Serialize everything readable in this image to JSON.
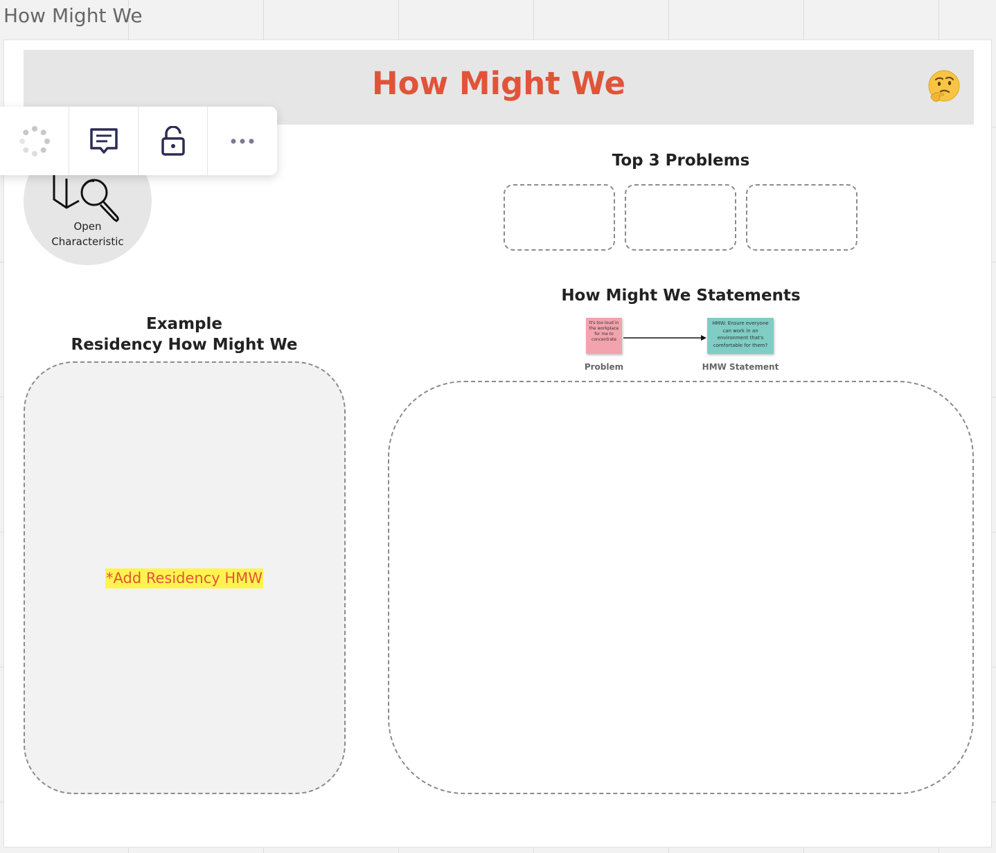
{
  "frame": {
    "title": "How Might We"
  },
  "banner": {
    "title": "How Might We",
    "emoji": "thinking-face-icon"
  },
  "method_card": {
    "line1": "Open",
    "line2": "Characteristic"
  },
  "toolbar": {
    "items": [
      "loading-icon",
      "comment-icon",
      "unlock-icon",
      "more-icon"
    ]
  },
  "top_problems": {
    "heading": "Top 3 Problems",
    "box_count": 3
  },
  "hmw_statements": {
    "heading": "How Might We Statements",
    "example_problem": {
      "text": "It's too loud in the workplace for me to concentrate",
      "label": "Problem",
      "color": "#f2a3ad"
    },
    "example_hmw": {
      "text": "HMW: Ensure everyone can work in an environment that's comfortable for them?",
      "label": "HMW Statement",
      "color": "#7fcdc4"
    }
  },
  "residency": {
    "heading_line1": "Example",
    "heading_line2": "Residency How Might We",
    "placeholder": "*Add Residency HMW"
  },
  "colors": {
    "accent": "#e0543a",
    "highlight": "#fff44f",
    "banner_bg": "#e6e6e6"
  }
}
